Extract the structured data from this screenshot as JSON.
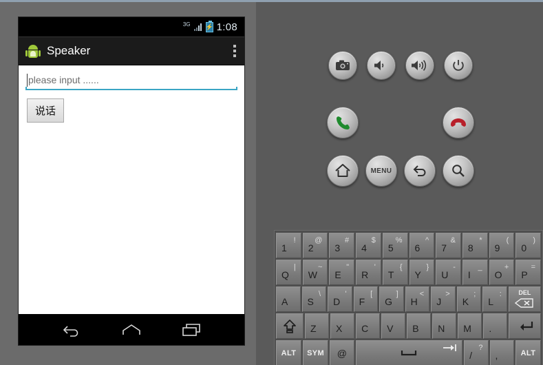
{
  "phone": {
    "status_bar": {
      "network": "3G",
      "battery_icon": "battery-charging-icon",
      "time": "1:08"
    },
    "app_bar": {
      "icon": "android-robot-icon",
      "title": "Speaker",
      "overflow": "overflow-menu-icon"
    },
    "content": {
      "input_placeholder": "please input ......",
      "input_value": "",
      "speak_button_label": "说话"
    },
    "nav_bar": {
      "back": "back-icon",
      "home": "home-icon",
      "recents": "recent-apps-icon"
    }
  },
  "controls": {
    "hardware_buttons": [
      {
        "name": "camera-button",
        "icon": "camera-icon"
      },
      {
        "name": "volume-down-button",
        "icon": "volume-down-icon"
      },
      {
        "name": "volume-up-button",
        "icon": "volume-up-icon"
      },
      {
        "name": "power-button",
        "icon": "power-icon"
      },
      {
        "name": "call-button",
        "icon": "phone-green-icon"
      },
      {
        "name": "end-call-button",
        "icon": "phone-red-icon"
      },
      {
        "name": "home-button",
        "icon": "home-outline-icon"
      },
      {
        "name": "menu-button",
        "icon": "menu-text",
        "label": "MENU"
      },
      {
        "name": "back-button",
        "icon": "back-arrow-icon"
      },
      {
        "name": "search-button",
        "icon": "search-icon"
      }
    ],
    "dpad": {
      "up": "dpad-up-arrow",
      "down": "dpad-down-arrow",
      "left": "dpad-left-arrow",
      "right": "dpad-right-arrow",
      "center": "dpad-center-select"
    }
  },
  "keyboard": {
    "rows": [
      [
        {
          "main": "1",
          "alt": "!"
        },
        {
          "main": "2",
          "alt": "@"
        },
        {
          "main": "3",
          "alt": "#"
        },
        {
          "main": "4",
          "alt": "$"
        },
        {
          "main": "5",
          "alt": "%"
        },
        {
          "main": "6",
          "alt": "^"
        },
        {
          "main": "7",
          "alt": "&"
        },
        {
          "main": "8",
          "alt": "*"
        },
        {
          "main": "9",
          "alt": "("
        },
        {
          "main": "0",
          "alt": ")"
        }
      ],
      [
        {
          "main": "Q",
          "alt": "|"
        },
        {
          "main": "W",
          "alt": "~"
        },
        {
          "main": "E",
          "alt": "\""
        },
        {
          "main": "R",
          "alt": "'"
        },
        {
          "main": "T",
          "alt": "{"
        },
        {
          "main": "Y",
          "alt": "}"
        },
        {
          "main": "U",
          "alt": "-"
        },
        {
          "main": "I",
          "alt": "_"
        },
        {
          "main": "O",
          "alt": "+"
        },
        {
          "main": "P",
          "alt": "="
        }
      ],
      [
        {
          "main": "A",
          "alt": ""
        },
        {
          "main": "S",
          "alt": "\\"
        },
        {
          "main": "D",
          "alt": "'"
        },
        {
          "main": "F",
          "alt": "["
        },
        {
          "main": "G",
          "alt": "]"
        },
        {
          "main": "H",
          "alt": "<"
        },
        {
          "main": "J",
          "alt": ">"
        },
        {
          "main": "K",
          "alt": ";"
        },
        {
          "main": "L",
          "alt": ":"
        },
        {
          "main": "DEL",
          "alt": ""
        }
      ],
      [
        {
          "main": "SHIFT",
          "alt": ""
        },
        {
          "main": "Z",
          "alt": ""
        },
        {
          "main": "X",
          "alt": ""
        },
        {
          "main": "C",
          "alt": ""
        },
        {
          "main": "V",
          "alt": ""
        },
        {
          "main": "B",
          "alt": ""
        },
        {
          "main": "N",
          "alt": ""
        },
        {
          "main": "M",
          "alt": ""
        },
        {
          "main": ".",
          "alt": ""
        },
        {
          "main": "ENTER",
          "alt": ""
        }
      ],
      [
        {
          "main": "ALT",
          "alt": ""
        },
        {
          "main": "SYM",
          "alt": ""
        },
        {
          "main": "@",
          "alt": ""
        },
        {
          "main": "SPACE",
          "alt": ""
        },
        {
          "main": "/",
          "alt": "?"
        },
        {
          "main": ",",
          "alt": ""
        },
        {
          "main": "ALT",
          "alt": ""
        }
      ]
    ],
    "del_label": "DEL",
    "alt_label": "ALT",
    "sym_label": "SYM"
  }
}
